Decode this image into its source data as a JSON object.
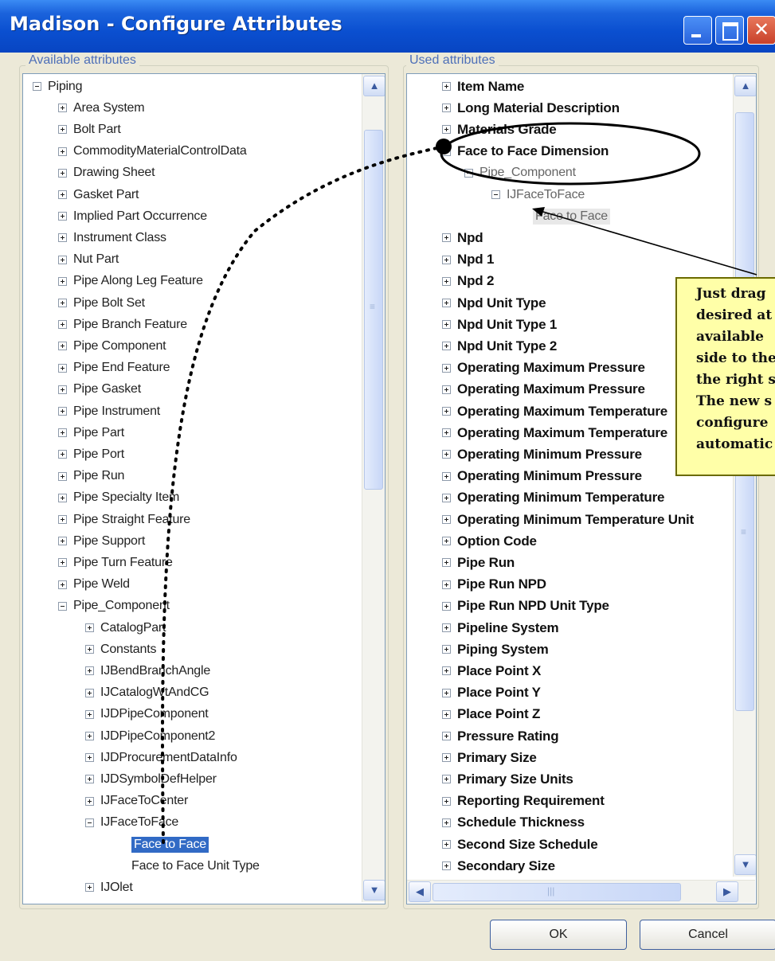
{
  "window": {
    "title": "Madison - Configure Attributes",
    "minimize_glyph": "",
    "maximize_glyph": "",
    "close_glyph": "✕"
  },
  "available": {
    "legend": "Available attributes",
    "items": [
      {
        "label": "Piping",
        "expander": "minus"
      },
      {
        "label": "Area System",
        "expander": "plus"
      },
      {
        "label": "Bolt Part",
        "expander": "plus"
      },
      {
        "label": "CommodityMaterialControlData",
        "expander": "plus"
      },
      {
        "label": "Drawing Sheet",
        "expander": "plus"
      },
      {
        "label": "Gasket Part",
        "expander": "plus"
      },
      {
        "label": "Implied Part Occurrence",
        "expander": "plus"
      },
      {
        "label": "Instrument Class",
        "expander": "plus"
      },
      {
        "label": "Nut Part",
        "expander": "plus"
      },
      {
        "label": "Pipe Along Leg Feature",
        "expander": "plus"
      },
      {
        "label": "Pipe Bolt Set",
        "expander": "plus"
      },
      {
        "label": "Pipe Branch Feature",
        "expander": "plus"
      },
      {
        "label": "Pipe Component",
        "expander": "plus"
      },
      {
        "label": "Pipe End Feature",
        "expander": "plus"
      },
      {
        "label": "Pipe Gasket",
        "expander": "plus"
      },
      {
        "label": "Pipe Instrument",
        "expander": "plus"
      },
      {
        "label": "Pipe Part",
        "expander": "plus"
      },
      {
        "label": "Pipe Port",
        "expander": "plus"
      },
      {
        "label": "Pipe Run",
        "expander": "plus"
      },
      {
        "label": "Pipe Specialty Item",
        "expander": "plus"
      },
      {
        "label": "Pipe Straight Feature",
        "expander": "plus"
      },
      {
        "label": "Pipe Support",
        "expander": "plus"
      },
      {
        "label": "Pipe Turn Feature",
        "expander": "plus"
      },
      {
        "label": "Pipe Weld",
        "expander": "plus"
      },
      {
        "label": "Pipe_Component",
        "expander": "minus"
      },
      {
        "label": "CatalogPart",
        "expander": "plus"
      },
      {
        "label": "Constants",
        "expander": "plus"
      },
      {
        "label": "IJBendBranchAngle",
        "expander": "plus"
      },
      {
        "label": "IJCatalogWtAndCG",
        "expander": "plus"
      },
      {
        "label": "IJDPipeComponent",
        "expander": "plus"
      },
      {
        "label": "IJDPipeComponent2",
        "expander": "plus"
      },
      {
        "label": "IJDProcurementDataInfo",
        "expander": "plus"
      },
      {
        "label": "IJDSymbolDefHelper",
        "expander": "plus"
      },
      {
        "label": "IJFaceToCenter",
        "expander": "plus"
      },
      {
        "label": "IJFaceToFace",
        "expander": "minus"
      },
      {
        "label": "Face to Face",
        "expander": "none",
        "selected": true
      },
      {
        "label": "Face to Face Unit Type",
        "expander": "none"
      },
      {
        "label": "IJOlet",
        "expander": "plus"
      }
    ]
  },
  "used": {
    "legend": "Used attributes",
    "items": [
      {
        "label": "Item Name",
        "expander": "plus"
      },
      {
        "label": "Long Material Description",
        "expander": "plus"
      },
      {
        "label": "Materials Grade",
        "expander": "plus"
      },
      {
        "label": "Face to Face Dimension",
        "expander": "minus"
      },
      {
        "label": "Pipe_Component",
        "expander": "minus"
      },
      {
        "label": "IJFaceToFace",
        "expander": "minus"
      },
      {
        "label": "Face to Face",
        "expander": "none"
      },
      {
        "label": "Npd",
        "expander": "plus"
      },
      {
        "label": "Npd 1",
        "expander": "plus"
      },
      {
        "label": "Npd 2",
        "expander": "plus"
      },
      {
        "label": "Npd Unit Type",
        "expander": "plus"
      },
      {
        "label": "Npd Unit Type 1",
        "expander": "plus"
      },
      {
        "label": "Npd Unit Type 2",
        "expander": "plus"
      },
      {
        "label": "Operating Maximum Pressure",
        "expander": "plus"
      },
      {
        "label": "Operating Maximum Pressure",
        "expander": "plus"
      },
      {
        "label": "Operating Maximum Temperature",
        "expander": "plus"
      },
      {
        "label": "Operating Maximum Temperature",
        "expander": "plus"
      },
      {
        "label": "Operating Minimum Pressure",
        "expander": "plus"
      },
      {
        "label": "Operating Minimum Pressure",
        "expander": "plus"
      },
      {
        "label": "Operating Minimum Temperature",
        "expander": "plus"
      },
      {
        "label": "Operating Minimum Temperature Unit",
        "expander": "plus"
      },
      {
        "label": "Option Code",
        "expander": "plus"
      },
      {
        "label": "Pipe Run",
        "expander": "plus"
      },
      {
        "label": "Pipe Run NPD",
        "expander": "plus"
      },
      {
        "label": "Pipe Run NPD Unit Type",
        "expander": "plus"
      },
      {
        "label": "Pipeline System",
        "expander": "plus"
      },
      {
        "label": "Piping System",
        "expander": "plus"
      },
      {
        "label": "Place Point X",
        "expander": "plus"
      },
      {
        "label": "Place Point Y",
        "expander": "plus"
      },
      {
        "label": "Place Point Z",
        "expander": "plus"
      },
      {
        "label": "Pressure Rating",
        "expander": "plus"
      },
      {
        "label": "Primary Size",
        "expander": "plus"
      },
      {
        "label": "Primary Size Units",
        "expander": "plus"
      },
      {
        "label": "Reporting Requirement",
        "expander": "plus"
      },
      {
        "label": "Schedule Thickness",
        "expander": "plus"
      },
      {
        "label": "Second Size Schedule",
        "expander": "plus"
      },
      {
        "label": "Secondary Size",
        "expander": "plus"
      }
    ]
  },
  "callout": {
    "lines": [
      "Just drag",
      "desired at",
      "available",
      "side to the",
      "the right s",
      "The new s",
      "configure",
      "automatic"
    ]
  },
  "buttons": {
    "ok": "OK",
    "cancel": "Cancel"
  },
  "scroll": {
    "up": "▲",
    "down": "▼",
    "left": "◀",
    "right": "▶",
    "grip": "≡",
    "hgrip": "|||"
  },
  "colors": {
    "titlebar": "#0a4fd0",
    "selection": "#316ac5",
    "callout": "#ffffa8"
  }
}
